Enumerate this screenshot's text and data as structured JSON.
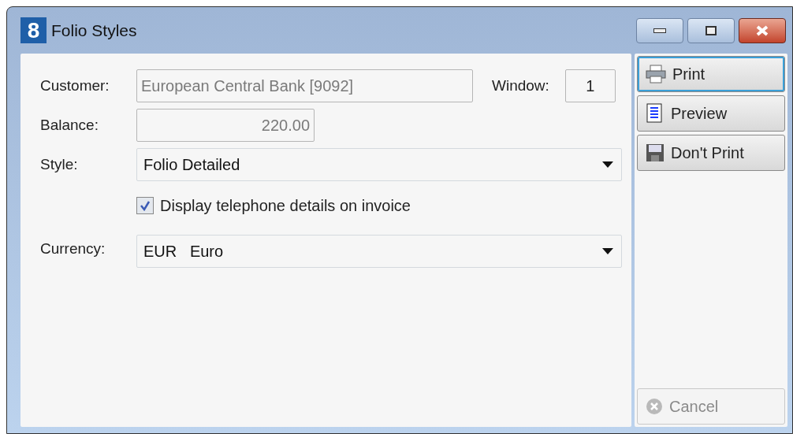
{
  "window": {
    "logo": "8",
    "title": "Folio Styles"
  },
  "fields": [
    {
      "label": "Customer:",
      "value": "European Central Bank [9092]",
      "disabled": true
    },
    {
      "label": "Window:",
      "value": "1",
      "disabled": false
    },
    {
      "label": "Balance:",
      "value": "220.00",
      "disabled": true
    },
    {
      "label": "Style:",
      "value": "Folio Detailed",
      "disabled": false
    },
    {
      "label": "Currency:",
      "value": "EUR   Euro",
      "disabled": false
    }
  ],
  "checkbox": {
    "label": "Display telephone details on invoice",
    "checked": true
  },
  "buttons": [
    {
      "kind": "print",
      "label": "Print",
      "focused": true,
      "disabled": false
    },
    {
      "kind": "preview",
      "label": "Preview",
      "focused": false,
      "disabled": false
    },
    {
      "kind": "dont-print",
      "label": "Don't Print",
      "focused": false,
      "disabled": false
    },
    {
      "kind": "cancel",
      "label": "Cancel",
      "focused": false,
      "disabled": true
    }
  ]
}
